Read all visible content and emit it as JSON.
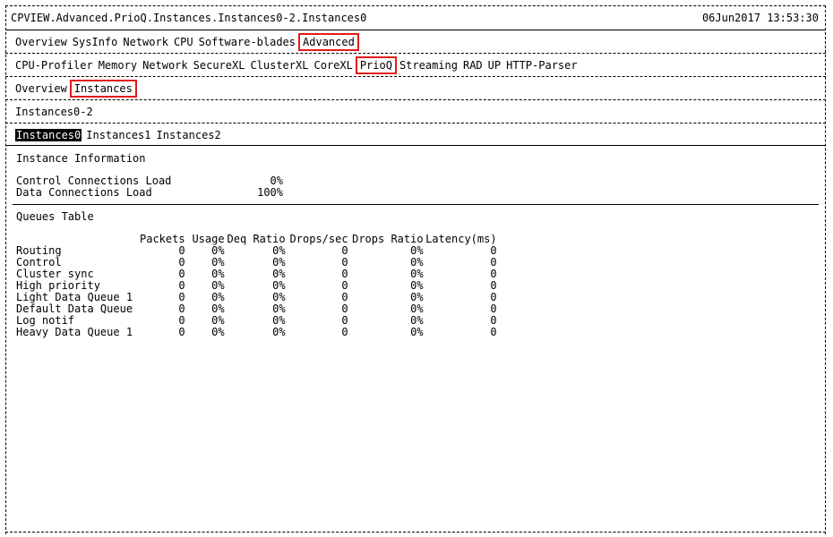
{
  "header": {
    "path": "CPVIEW.Advanced.PrioQ.Instances.Instances0-2.Instances0",
    "datetime": "06Jun2017 13:53:30"
  },
  "menu1": [
    "Overview",
    "SysInfo",
    "Network",
    "CPU",
    "Software-blades",
    "Advanced"
  ],
  "menu2": [
    "CPU-Profiler",
    "Memory",
    "Network",
    "SecureXL",
    "ClusterXL",
    "CoreXL",
    "PrioQ",
    "Streaming",
    "RAD",
    "UP",
    "HTTP-Parser"
  ],
  "menu3": [
    "Overview",
    "Instances"
  ],
  "group_title": "Instances0-2",
  "menu4": [
    "Instances0",
    "Instances1",
    "Instances2"
  ],
  "instance_info": {
    "title": "Instance Information",
    "rows": [
      {
        "label": "Control Connections Load",
        "value": "0%"
      },
      {
        "label": "Data Connections Load",
        "value": "100%"
      }
    ]
  },
  "queues": {
    "title": "Queues Table",
    "columns": [
      "",
      "Packets",
      "Usage",
      "Deq Ratio",
      "Drops/sec",
      "Drops Ratio",
      "Latency(ms)"
    ],
    "rows": [
      [
        "Routing",
        "0",
        "0%",
        "0%",
        "0",
        "0%",
        "0"
      ],
      [
        "Control",
        "0",
        "0%",
        "0%",
        "0",
        "0%",
        "0"
      ],
      [
        "Cluster sync",
        "0",
        "0%",
        "0%",
        "0",
        "0%",
        "0"
      ],
      [
        "High priority",
        "0",
        "0%",
        "0%",
        "0",
        "0%",
        "0"
      ],
      [
        "Light Data Queue 1",
        "0",
        "0%",
        "0%",
        "0",
        "0%",
        "0"
      ],
      [
        "Default Data Queue",
        "0",
        "0%",
        "0%",
        "0",
        "0%",
        "0"
      ],
      [
        "Log notif",
        "0",
        "0%",
        "0%",
        "0",
        "0%",
        "0"
      ],
      [
        "Heavy Data Queue 1",
        "0",
        "0%",
        "0%",
        "0",
        "0%",
        "0"
      ]
    ]
  },
  "highlight_color": "#e21b1b"
}
